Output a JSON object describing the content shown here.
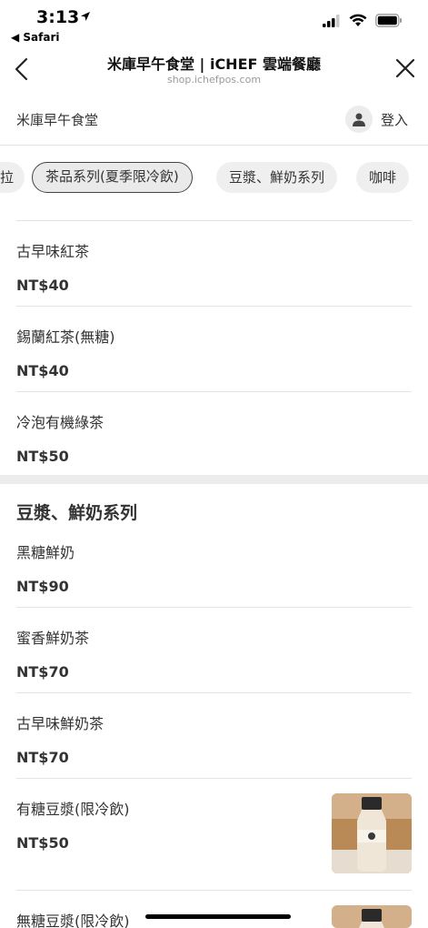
{
  "status_bar": {
    "time": "3:13",
    "back_app": "◀ Safari"
  },
  "nav": {
    "title": "米庫早午食堂 | iCHEF 雲端餐廳",
    "url": "shop.ichefpos.com"
  },
  "store": {
    "name": "米庫早午食堂",
    "login_label": "登入"
  },
  "categories": [
    {
      "label": "拉"
    },
    {
      "label": "茶品系列(夏季限冷飲)",
      "active": true
    },
    {
      "label": "豆漿、鮮奶系列"
    },
    {
      "label": "咖啡"
    }
  ],
  "tea_items": [
    {
      "name": "古早味紅茶",
      "price": "NT$40"
    },
    {
      "name": "錫蘭紅茶(無糖)",
      "price": "NT$40"
    },
    {
      "name": "冷泡有機綠茶",
      "price": "NT$50"
    }
  ],
  "milk_section": {
    "title": "豆漿、鮮奶系列",
    "items": [
      {
        "name": "黑糖鮮奶",
        "price": "NT$90"
      },
      {
        "name": "蜜香鮮奶茶",
        "price": "NT$70"
      },
      {
        "name": "古早味鮮奶茶",
        "price": "NT$70"
      },
      {
        "name": "有糖豆漿(限冷飲)",
        "price": "NT$50"
      },
      {
        "name": "無糖豆漿(限冷飲)",
        "price": ""
      }
    ]
  },
  "colors": {
    "chip_bg": "#efefef",
    "divider": "#e4e4e4",
    "text": "#333333"
  }
}
